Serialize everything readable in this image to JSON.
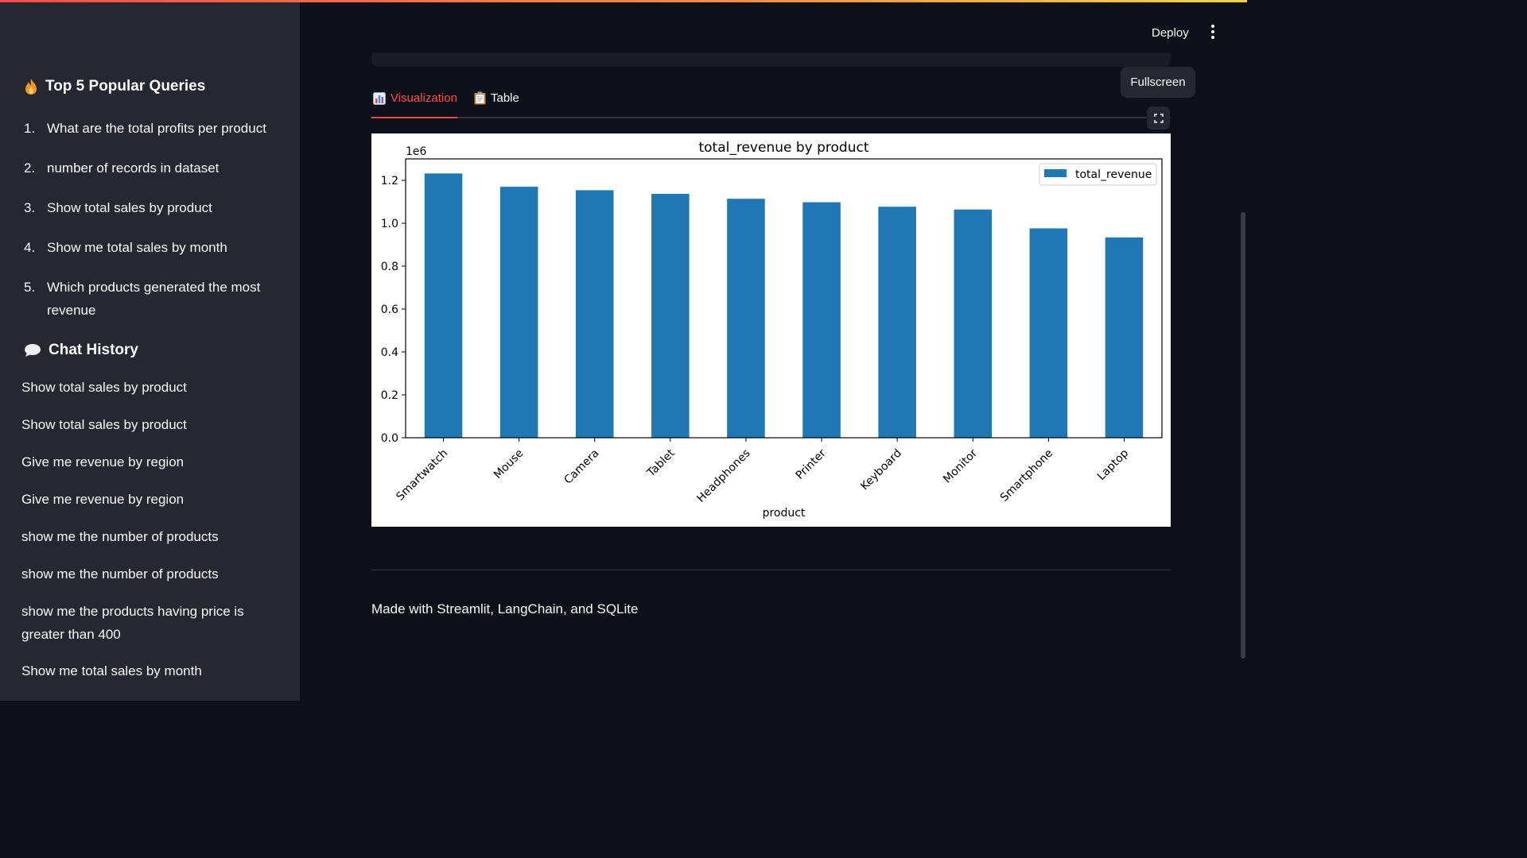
{
  "sidebar": {
    "popular_heading": "Top 5 Popular Queries",
    "popular_queries": [
      {
        "num": "1.",
        "text": "What are the total profits per product"
      },
      {
        "num": "2.",
        "text": "number of records in dataset"
      },
      {
        "num": "3.",
        "text": "Show total sales by product"
      },
      {
        "num": "4.",
        "text": "Show me total sales by month"
      },
      {
        "num": "5.",
        "text": "Which products generated the most revenue"
      }
    ],
    "history_heading": "Chat History",
    "history": [
      "Show total sales by product",
      "Show total sales by product",
      "Give me revenue by region",
      "Give me revenue by region",
      "show me the number of products",
      "show me the number of products",
      "show me the products having price is greater than 400",
      "Show me total sales by month"
    ]
  },
  "header": {
    "deploy_label": "Deploy"
  },
  "tooltip": "Fullscreen",
  "tabs": [
    {
      "label": "Visualization",
      "icon": "bar-chart-icon",
      "active": true
    },
    {
      "label": "Table",
      "icon": "clipboard-icon",
      "active": false
    }
  ],
  "footer": "Made with Streamlit, LangChain, and SQLite",
  "colors": {
    "accent": "#ff4b4b",
    "bar": "#1f77b4",
    "sidebar_bg": "#262730",
    "main_bg": "#0e1117"
  },
  "chart_data": {
    "type": "bar",
    "title": "total_revenue by product",
    "xlabel": "product",
    "ylabel": "",
    "offset_label": "1e6",
    "categories": [
      "Smartwatch",
      "Mouse",
      "Camera",
      "Tablet",
      "Headphones",
      "Printer",
      "Keyboard",
      "Monitor",
      "Smartphone",
      "Laptop"
    ],
    "series": [
      {
        "name": "total_revenue",
        "values": [
          1232000,
          1170000,
          1154000,
          1137000,
          1114000,
          1098000,
          1077000,
          1064000,
          976000,
          934000
        ]
      }
    ],
    "ylim": [
      0,
      1.3
    ],
    "yticks": [
      "0.0",
      "0.2",
      "0.4",
      "0.6",
      "0.8",
      "1.0",
      "1.2"
    ],
    "legend": "top-right",
    "grid": false
  }
}
